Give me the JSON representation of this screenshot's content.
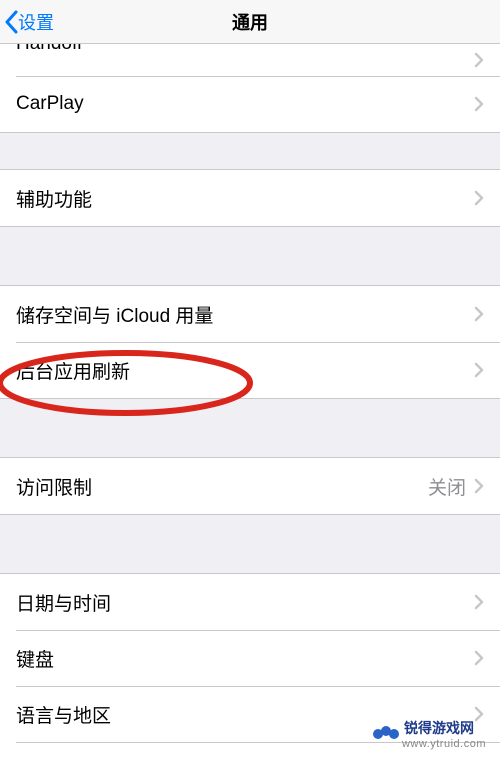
{
  "navbar": {
    "back_label": "设置",
    "title": "通用"
  },
  "group1": {
    "handoff": "Handoff",
    "carplay": "CarPlay"
  },
  "group2": {
    "accessibility": "辅助功能"
  },
  "group3": {
    "storage_icloud": "储存空间与 iCloud 用量",
    "background_refresh": "后台应用刷新"
  },
  "group4": {
    "restrictions": "访问限制",
    "restrictions_value": "关闭"
  },
  "group5": {
    "datetime": "日期与时间",
    "keyboard": "键盘",
    "language_region": "语言与地区"
  },
  "watermark": {
    "brand": "锐得游戏网",
    "url": "www.ytruid.com"
  }
}
